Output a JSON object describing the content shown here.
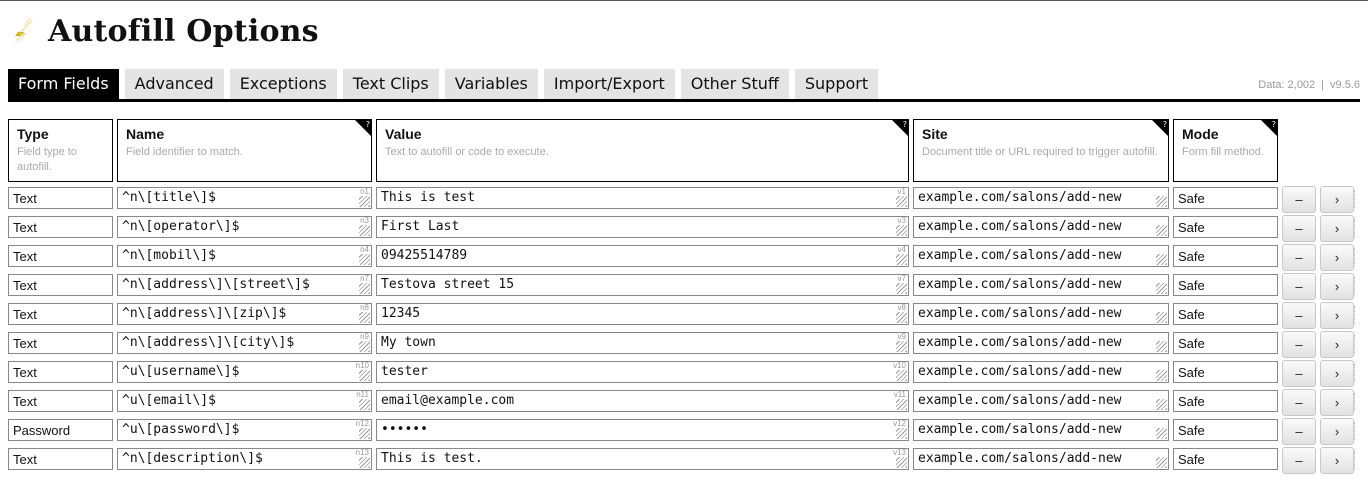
{
  "app": {
    "title": "Autofill Options"
  },
  "tabs": [
    {
      "label": "Form Fields",
      "active": true
    },
    {
      "label": "Advanced",
      "active": false
    },
    {
      "label": "Exceptions",
      "active": false
    },
    {
      "label": "Text Clips",
      "active": false
    },
    {
      "label": "Variables",
      "active": false
    },
    {
      "label": "Import/Export",
      "active": false
    },
    {
      "label": "Other Stuff",
      "active": false
    },
    {
      "label": "Support",
      "active": false
    }
  ],
  "meta": {
    "data_count": "Data: 2,002",
    "separator": "|",
    "version": "v9.5.6"
  },
  "columns": {
    "type": {
      "title": "Type",
      "desc": "Field type to autofill."
    },
    "name": {
      "title": "Name",
      "desc": "Field identifier to match.",
      "help": "?"
    },
    "value": {
      "title": "Value",
      "desc": "Text to autofill or code to execute.",
      "help": "?"
    },
    "site": {
      "title": "Site",
      "desc": "Document title or URL required to trigger autofill.",
      "help": "?"
    },
    "mode": {
      "title": "Mode",
      "desc": "Form fill method.",
      "help": "?"
    }
  },
  "rows": [
    {
      "type": "Text",
      "name": "^n\\[title\\]$",
      "name_tag": "n1",
      "value": "This is test",
      "value_tag": "v1",
      "site": "example.com/salons/add-new",
      "mode": "Safe",
      "remove": "–",
      "more": "›"
    },
    {
      "type": "Text",
      "name": "^n\\[operator\\]$",
      "name_tag": "n3",
      "value": "First Last",
      "value_tag": "v3",
      "site": "example.com/salons/add-new",
      "mode": "Safe",
      "remove": "–",
      "more": "›"
    },
    {
      "type": "Text",
      "name": "^n\\[mobil\\]$",
      "name_tag": "n4",
      "value": "09425514789",
      "value_tag": "v4",
      "site": "example.com/salons/add-new",
      "mode": "Safe",
      "remove": "–",
      "more": "›"
    },
    {
      "type": "Text",
      "name": "^n\\[address\\]\\[street\\]$",
      "name_tag": "n7",
      "value": "Testova street 15",
      "value_tag": "v7",
      "site": "example.com/salons/add-new",
      "mode": "Safe",
      "remove": "–",
      "more": "›"
    },
    {
      "type": "Text",
      "name": "^n\\[address\\]\\[zip\\]$",
      "name_tag": "n8",
      "value": "12345",
      "value_tag": "v8",
      "site": "example.com/salons/add-new",
      "mode": "Safe",
      "remove": "–",
      "more": "›"
    },
    {
      "type": "Text",
      "name": "^n\\[address\\]\\[city\\]$",
      "name_tag": "n9",
      "value": "My town",
      "value_tag": "v9",
      "site": "example.com/salons/add-new",
      "mode": "Safe",
      "remove": "–",
      "more": "›"
    },
    {
      "type": "Text",
      "name": "^u\\[username\\]$",
      "name_tag": "n10",
      "value": "tester",
      "value_tag": "v10",
      "site": "example.com/salons/add-new",
      "mode": "Safe",
      "remove": "–",
      "more": "›"
    },
    {
      "type": "Text",
      "name": "^u\\[email\\]$",
      "name_tag": "n11",
      "value": "email@example.com",
      "value_tag": "v11",
      "site": "example.com/salons/add-new",
      "mode": "Safe",
      "remove": "–",
      "more": "›"
    },
    {
      "type": "Password",
      "name": "^u\\[password\\]$",
      "name_tag": "n12",
      "value": "••••••",
      "value_tag": "v12",
      "site": "example.com/salons/add-new",
      "mode": "Safe",
      "remove": "–",
      "more": "›"
    },
    {
      "type": "Text",
      "name": "^n\\[description\\]$",
      "name_tag": "n13",
      "value": "This is test.",
      "value_tag": "v13",
      "site": "example.com/salons/add-new",
      "mode": "Safe",
      "remove": "–",
      "more": "›"
    }
  ]
}
